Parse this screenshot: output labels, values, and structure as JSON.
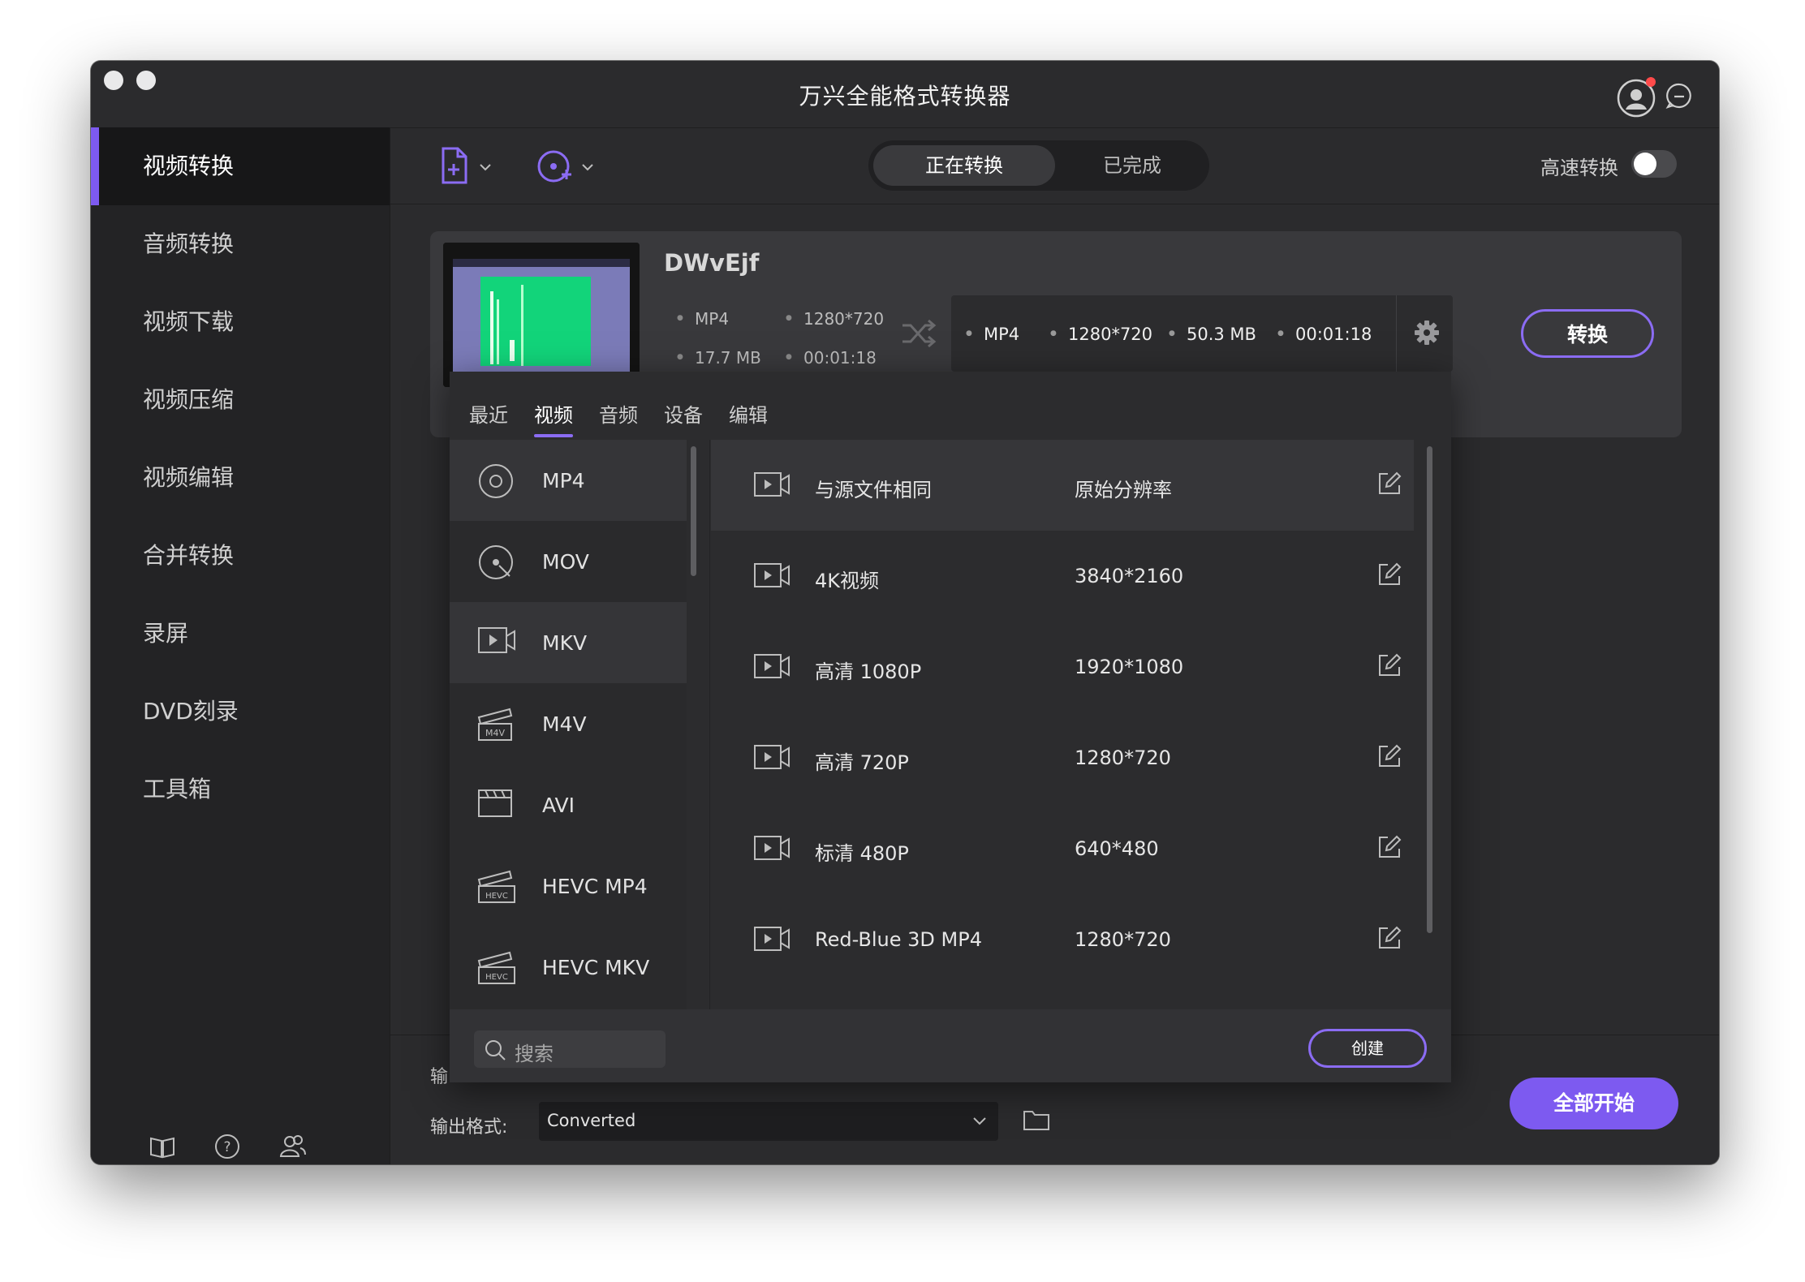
{
  "window": {
    "title": "万兴全能格式转换器"
  },
  "sidebar": {
    "items": [
      {
        "label": "视频转换",
        "active": true
      },
      {
        "label": "音频转换"
      },
      {
        "label": "视频下载"
      },
      {
        "label": "视频压缩"
      },
      {
        "label": "视频编辑"
      },
      {
        "label": "合并转换"
      },
      {
        "label": "录屏"
      },
      {
        "label": "DVD刻录"
      },
      {
        "label": "工具箱"
      }
    ],
    "bottom_icons": [
      "book-icon",
      "help-icon",
      "users-icon"
    ]
  },
  "toolbar": {
    "add_file_icon": "add-file-icon",
    "add_dvd_icon": "add-dvd-icon",
    "tabs": [
      {
        "label": "正在转换",
        "active": true
      },
      {
        "label": "已完成"
      }
    ],
    "speed_label": "高速转换",
    "speed_on": false
  },
  "file": {
    "name": "DWvEjf",
    "source": {
      "format": "MP4",
      "resolution": "1280*720",
      "size": "17.7 MB",
      "duration": "00:01:18"
    },
    "target": {
      "format": "MP4",
      "resolution": "1280*720",
      "size": "50.3 MB",
      "duration": "00:01:18"
    },
    "convert_label": "转换"
  },
  "format_panel": {
    "tabs": [
      {
        "label": "最近"
      },
      {
        "label": "视频",
        "active": true
      },
      {
        "label": "音频"
      },
      {
        "label": "设备"
      },
      {
        "label": "编辑"
      }
    ],
    "formats": [
      {
        "label": "MP4",
        "icon": "disc-icon",
        "selected": true
      },
      {
        "label": "MOV",
        "icon": "disc-search-icon"
      },
      {
        "label": "MKV",
        "icon": "video-icon",
        "selected": true
      },
      {
        "label": "M4V",
        "icon": "m4v-icon"
      },
      {
        "label": "AVI",
        "icon": "clapper-icon"
      },
      {
        "label": "HEVC MP4",
        "icon": "hevc-icon"
      },
      {
        "label": "HEVC MKV",
        "icon": "hevc-icon"
      }
    ],
    "presets": [
      {
        "name": "与源文件相同",
        "resolution": "原始分辨率",
        "selected": true
      },
      {
        "name": "4K视频",
        "resolution": "3840*2160"
      },
      {
        "name": "高清 1080P",
        "resolution": "1920*1080"
      },
      {
        "name": "高清 720P",
        "resolution": "1280*720"
      },
      {
        "name": "标清 480P",
        "resolution": "640*480"
      },
      {
        "name": "Red-Blue 3D MP4",
        "resolution": "1280*720"
      }
    ],
    "search_placeholder": "搜索",
    "create_label": "创建"
  },
  "bottom": {
    "output_prefix": "输",
    "output_format_label": "输出格式:",
    "output_value": "Converted",
    "start_all_label": "全部开始"
  },
  "colors": {
    "accent": "#7d5af0",
    "background": "#2b2b2d",
    "sidebar": "#232325"
  }
}
